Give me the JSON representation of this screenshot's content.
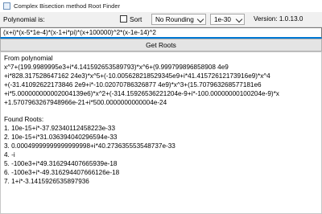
{
  "window": {
    "title": "Complex Bisection method Root Finder",
    "icon": "app-icon"
  },
  "toolbar": {
    "polynomial_label": "Polynomial is:",
    "sort_label": "Sort",
    "sort_checked": false,
    "rounding_value": "No Rounding",
    "precision_value": "1e-30",
    "version": "Version: 1.0.13.0"
  },
  "input": {
    "expression": "(x+i)*(x-5*1e-4)*(x-1+i*pi)*(x+100000)^2*(x-1e-14)^2"
  },
  "button": {
    "get_roots": "Get Roots"
  },
  "output": {
    "lines": [
      "From polynomial",
      "x^7+(199.9989995e3+i*4.141592653589793)*x^6+(9.999799896858908 4e9",
      "+i*828.317528647162 24e3)*x^5+(-10.005628218529345e9+i*41.41572612173916e9)*x^4",
      "+(-31.41092622173846 2e9+i*-10.02070786326877 4e9)*x^3+(15.707963268577181e6",
      "+i*5.000000000002004139e6)*x^2+(-314.15926536221204e-9+i*-100.00000000100204e-9)*x",
      "+1.5707963267948966e-21+i*500.0000000000004e-24",
      "",
      "Found Roots:",
      "1. 10e-15+i*-37.92340112458223e-33",
      "2. 10e-15+i*31.036394040296594e-33",
      "3. 0.00049999999999999998+i*40.273635553548737e-33",
      "4. -i",
      "5. -100e3+i*49.316294407665939e-18",
      "6. -100e3+i*-49.316294407666126e-18",
      "7. 1+i*-3.1415926535897936"
    ]
  }
}
